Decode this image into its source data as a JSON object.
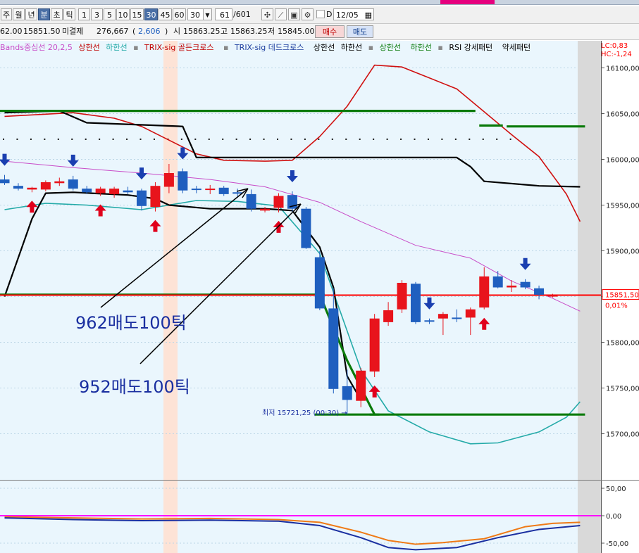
{
  "colors": {
    "up": "#e8141c",
    "down": "#1f5fbf",
    "bb_upper": "#c84cc8",
    "bb_lower": "#24aaa8",
    "trix_red": "#d01010",
    "signal_black": "#000000",
    "green_line": "#0a7a0a",
    "price_line": "#ff0000",
    "pink_line": "#ff00ff"
  },
  "toolbar": {
    "period_buttons": [
      "주",
      "월",
      "년",
      "분",
      "초",
      "틱"
    ],
    "interval_buttons": [
      "1",
      "3",
      "5",
      "10",
      "15",
      "30",
      "45",
      "60"
    ],
    "selected_period": "분",
    "selected_interval": "30",
    "interval_value": "30",
    "count_value": "61",
    "count_total": "/601",
    "d_label": "D",
    "date_value": "12/05"
  },
  "pricebar": {
    "prev_fragment": "62.00",
    "current_price": "15851.50",
    "open_interest_label": "미결제",
    "open_interest": "276,667",
    "oi_change": "2,606",
    "open_label": "시",
    "open": "15863.25",
    "high_label": "고",
    "high": "15863.25",
    "low_label": "저",
    "low": "15845.00",
    "buy_label": "매수",
    "sell_label": "매도"
  },
  "legend": {
    "bb": "Bands중심선 20,2,5",
    "bb_upper": "상한선",
    "bb_lower": "하한선",
    "trix_golden": "TRIX-sig 골든크로스",
    "trix_dead": "TRIX-sig 데드크로스",
    "upper1": "상한선",
    "lower1": "하한선",
    "upper2": "상한선",
    "lower2": "하한선",
    "rsi": "RSI 강세패턴",
    "weak": "약세패턴",
    "lc": "LC:0,83",
    "hc": "HC:-1,24"
  },
  "chart_data": {
    "type": "candlestick",
    "y_ticks": [
      "16100,00",
      "16050,00",
      "16000,00",
      "15950,00",
      "15900,00",
      "15850,00",
      "15800,00",
      "15750,00",
      "15700,00"
    ],
    "y_tick_values": [
      16100,
      16050,
      16000,
      15950,
      15900,
      15850,
      15800,
      15750,
      15700
    ],
    "ylim": [
      15648,
      16112
    ],
    "current_price_label": "15851,50",
    "current_change_label": "0,01%",
    "current_price": 15851.5,
    "low_annotation": "최저 15721,25 (00:30) →",
    "annotations": [
      "962매도100틱",
      "952매도100틱"
    ],
    "candles": [
      {
        "o": 15978,
        "h": 15983,
        "l": 15972,
        "c": 15974,
        "up": false
      },
      {
        "o": 15971,
        "h": 15974,
        "l": 15966,
        "c": 15968,
        "up": false
      },
      {
        "o": 15967,
        "h": 15970,
        "l": 15964,
        "c": 15969,
        "up": true
      },
      {
        "o": 15967,
        "h": 15977,
        "l": 15965,
        "c": 15975,
        "up": true
      },
      {
        "o": 15974,
        "h": 15980,
        "l": 15971,
        "c": 15976,
        "up": true
      },
      {
        "o": 15978,
        "h": 15982,
        "l": 15966,
        "c": 15968,
        "up": false
      },
      {
        "o": 15968,
        "h": 15971,
        "l": 15962,
        "c": 15964,
        "up": false
      },
      {
        "o": 15963,
        "h": 15970,
        "l": 15960,
        "c": 15968,
        "up": true
      },
      {
        "o": 15962,
        "h": 15970,
        "l": 15958,
        "c": 15968,
        "up": true
      },
      {
        "o": 15966,
        "h": 15970,
        "l": 15962,
        "c": 15964,
        "up": false
      },
      {
        "o": 15966,
        "h": 15968,
        "l": 15944,
        "c": 15949,
        "up": false
      },
      {
        "o": 15948,
        "h": 15975,
        "l": 15943,
        "c": 15971,
        "up": true
      },
      {
        "o": 15970,
        "h": 15995,
        "l": 15963,
        "c": 15985,
        "up": true
      },
      {
        "o": 15987,
        "h": 15990,
        "l": 15963,
        "c": 15966,
        "up": false
      },
      {
        "o": 15967,
        "h": 15971,
        "l": 15963,
        "c": 15968,
        "up": false
      },
      {
        "o": 15967,
        "h": 15972,
        "l": 15962,
        "c": 15968,
        "up": true
      },
      {
        "o": 15969,
        "h": 15971,
        "l": 15960,
        "c": 15962,
        "up": false
      },
      {
        "o": 15964,
        "h": 15968,
        "l": 15958,
        "c": 15963,
        "up": false
      },
      {
        "o": 15962,
        "h": 15967,
        "l": 15943,
        "c": 15946,
        "up": false
      },
      {
        "o": 15944,
        "h": 15948,
        "l": 15942,
        "c": 15946,
        "up": true
      },
      {
        "o": 15947,
        "h": 15963,
        "l": 15942,
        "c": 15960,
        "up": true
      },
      {
        "o": 15961,
        "h": 15965,
        "l": 15943,
        "c": 15946,
        "up": false
      },
      {
        "o": 15946,
        "h": 15948,
        "l": 15902,
        "c": 15903,
        "up": false
      },
      {
        "o": 15893,
        "h": 15900,
        "l": 15835,
        "c": 15837,
        "up": false
      },
      {
        "o": 15837,
        "h": 15859,
        "l": 15744,
        "c": 15749,
        "up": false
      },
      {
        "o": 15752,
        "h": 15770,
        "l": 15721,
        "c": 15737,
        "up": false
      },
      {
        "o": 15736,
        "h": 15772,
        "l": 15729,
        "c": 15769,
        "up": true
      },
      {
        "o": 15768,
        "h": 15831,
        "l": 15762,
        "c": 15826,
        "up": true
      },
      {
        "o": 15822,
        "h": 15844,
        "l": 15818,
        "c": 15835,
        "up": true
      },
      {
        "o": 15836,
        "h": 15868,
        "l": 15832,
        "c": 15865,
        "up": true
      },
      {
        "o": 15864,
        "h": 15866,
        "l": 15820,
        "c": 15822,
        "up": false
      },
      {
        "o": 15824,
        "h": 15826,
        "l": 15820,
        "c": 15823,
        "up": false
      },
      {
        "o": 15826,
        "h": 15833,
        "l": 15808,
        "c": 15831,
        "up": true
      },
      {
        "o": 15827,
        "h": 15836,
        "l": 15822,
        "c": 15827,
        "up": false
      },
      {
        "o": 15827,
        "h": 15838,
        "l": 15808,
        "c": 15836,
        "up": true
      },
      {
        "o": 15838,
        "h": 15882,
        "l": 15836,
        "c": 15872,
        "up": true
      },
      {
        "o": 15872,
        "h": 15878,
        "l": 15859,
        "c": 15860,
        "up": false
      },
      {
        "o": 15860,
        "h": 15868,
        "l": 15855,
        "c": 15862,
        "up": true
      },
      {
        "o": 15866,
        "h": 15869,
        "l": 15858,
        "c": 15860,
        "up": false
      },
      {
        "o": 15859,
        "h": 15862,
        "l": 15847,
        "c": 15852,
        "up": false
      },
      {
        "o": 15851,
        "h": 15853,
        "l": 15849,
        "c": 15851.5,
        "up": true
      }
    ],
    "signals": [
      {
        "i": 0,
        "dir": "down"
      },
      {
        "i": 2,
        "dir": "up"
      },
      {
        "i": 5,
        "dir": "down"
      },
      {
        "i": 7,
        "dir": "up"
      },
      {
        "i": 10,
        "dir": "down"
      },
      {
        "i": 11,
        "dir": "up"
      },
      {
        "i": 13,
        "dir": "down"
      },
      {
        "i": 21,
        "dir": "down"
      },
      {
        "i": 20,
        "dir": "up"
      },
      {
        "i": 27,
        "dir": "up"
      },
      {
        "i": 31,
        "dir": "down"
      },
      {
        "i": 35,
        "dir": "up"
      },
      {
        "i": 38,
        "dir": "down"
      }
    ],
    "bb_upper": [
      [
        0,
        15998
      ],
      [
        5,
        15991
      ],
      [
        10,
        15985
      ],
      [
        15,
        15978
      ],
      [
        19,
        15970
      ],
      [
        23,
        15953
      ],
      [
        26,
        15932
      ],
      [
        30,
        15906
      ],
      [
        34,
        15892
      ],
      [
        37,
        15867
      ],
      [
        40,
        15848
      ],
      [
        42,
        15834
      ]
    ],
    "bb_lower": [
      [
        0,
        15945
      ],
      [
        3,
        15952
      ],
      [
        6,
        15950
      ],
      [
        10,
        15945
      ],
      [
        14,
        15955
      ],
      [
        17,
        15954
      ],
      [
        20,
        15949
      ],
      [
        23,
        15897
      ],
      [
        26,
        15770
      ],
      [
        28,
        15725
      ],
      [
        31,
        15702
      ],
      [
        34,
        15689
      ],
      [
        36,
        15690
      ],
      [
        39,
        15702
      ],
      [
        41,
        15718
      ],
      [
        42,
        15735
      ]
    ],
    "trix_red": [
      [
        0,
        16047
      ],
      [
        5,
        16051
      ],
      [
        8,
        16045
      ],
      [
        10,
        16036
      ],
      [
        12,
        16021
      ],
      [
        14,
        16006
      ],
      [
        16,
        15999
      ],
      [
        19,
        15998
      ],
      [
        21,
        15999
      ],
      [
        23,
        16025
      ],
      [
        25,
        16058
      ],
      [
        27,
        16103
      ],
      [
        29,
        16101
      ],
      [
        31,
        16089
      ],
      [
        33,
        16077
      ],
      [
        35,
        16052
      ],
      [
        37,
        16027
      ],
      [
        39,
        16003
      ],
      [
        41,
        15962
      ],
      [
        42,
        15932
      ]
    ],
    "signal_black": [
      [
        0,
        15850
      ],
      [
        2,
        15935
      ],
      [
        3,
        15963
      ],
      [
        5,
        15964
      ],
      [
        9,
        15961
      ],
      [
        11,
        15957
      ],
      [
        12,
        15950
      ],
      [
        15,
        15946
      ],
      [
        19,
        15946
      ],
      [
        21,
        15944
      ],
      [
        23,
        15904
      ],
      [
        24,
        15860
      ],
      [
        25,
        15763
      ],
      [
        26,
        15737
      ]
    ],
    "black_upper": [
      [
        0,
        16051
      ],
      [
        4,
        16053
      ],
      [
        6,
        16040
      ],
      [
        13,
        16036
      ],
      [
        14,
        16002
      ],
      [
        20,
        16002
      ],
      [
        33,
        16002
      ],
      [
        34,
        15992
      ],
      [
        35,
        15976
      ],
      [
        39,
        15971
      ],
      [
        42,
        15970
      ]
    ],
    "green_levels": [
      {
        "from": 0,
        "to": 34,
        "y": 16053
      },
      {
        "from": 35,
        "to": 36,
        "y": 16037
      },
      {
        "from": 37,
        "to": 42,
        "y": 16036
      },
      {
        "from": 0,
        "to": 23,
        "y": 15852
      },
      {
        "from": 23,
        "to": 27,
        "y": 15721
      },
      {
        "from": 27,
        "to": 42,
        "y": 15721
      }
    ],
    "green_diag": [
      [
        23,
        15852
      ],
      [
        25,
        15780
      ],
      [
        27,
        15721
      ]
    ],
    "dots_y": 16022,
    "dots_count": 38,
    "sub_y_ticks": [
      "50,00",
      "0,00",
      "-50,00"
    ],
    "sub_y_values": [
      50,
      0,
      -50
    ],
    "sub_orange": [
      [
        0,
        -2
      ],
      [
        5,
        -4
      ],
      [
        10,
        -6
      ],
      [
        15,
        -5
      ],
      [
        20,
        -7
      ],
      [
        23,
        -12
      ],
      [
        26,
        -30
      ],
      [
        28,
        -45
      ],
      [
        30,
        -52
      ],
      [
        32,
        -49
      ],
      [
        35,
        -42
      ],
      [
        38,
        -20
      ],
      [
        40,
        -14
      ],
      [
        42,
        -12
      ]
    ],
    "sub_blue": [
      [
        0,
        -4
      ],
      [
        5,
        -7
      ],
      [
        10,
        -9
      ],
      [
        15,
        -8
      ],
      [
        20,
        -10
      ],
      [
        23,
        -18
      ],
      [
        26,
        -40
      ],
      [
        28,
        -58
      ],
      [
        30,
        -62
      ],
      [
        33,
        -58
      ],
      [
        36,
        -40
      ],
      [
        39,
        -25
      ],
      [
        42,
        -18
      ]
    ],
    "sub_zero_level": 0
  }
}
